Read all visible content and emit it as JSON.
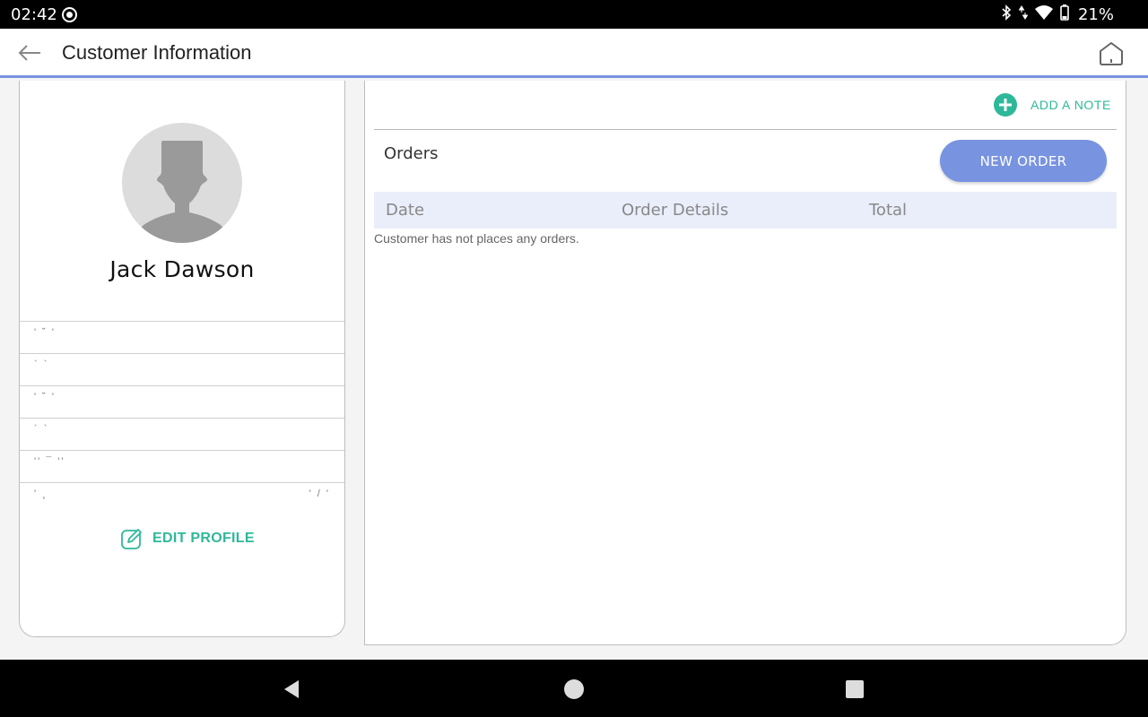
{
  "status_bar": {
    "time": "02:42",
    "battery_percent": "21%"
  },
  "app_bar": {
    "title": "Customer Information",
    "back_icon": "arrow-left-icon",
    "home_icon": "home-icon"
  },
  "customer": {
    "name": "Jack Dawson",
    "info_rows": [
      {
        "left": "' ˘ '",
        "right": ""
      },
      {
        "left": "` `",
        "right": ""
      },
      {
        "left": "' ˘ '",
        "right": ""
      },
      {
        "left": "´ `",
        "right": ""
      },
      {
        "left": "'' ¯ ''",
        "right": ""
      },
      {
        "left": "' ¸",
        "right": "' / '"
      }
    ],
    "edit_profile_label": "EDIT PROFILE"
  },
  "orders_panel": {
    "add_note_label": "ADD A NOTE",
    "title": "Orders",
    "new_order_label": "NEW ORDER",
    "columns": [
      "Date",
      "Order Details",
      "Total"
    ],
    "empty_message": "Customer has not places any orders."
  },
  "colors": {
    "accent_blue": "#7893e0",
    "accent_green": "#2eb89a",
    "table_header_bg": "#eaeefa"
  }
}
